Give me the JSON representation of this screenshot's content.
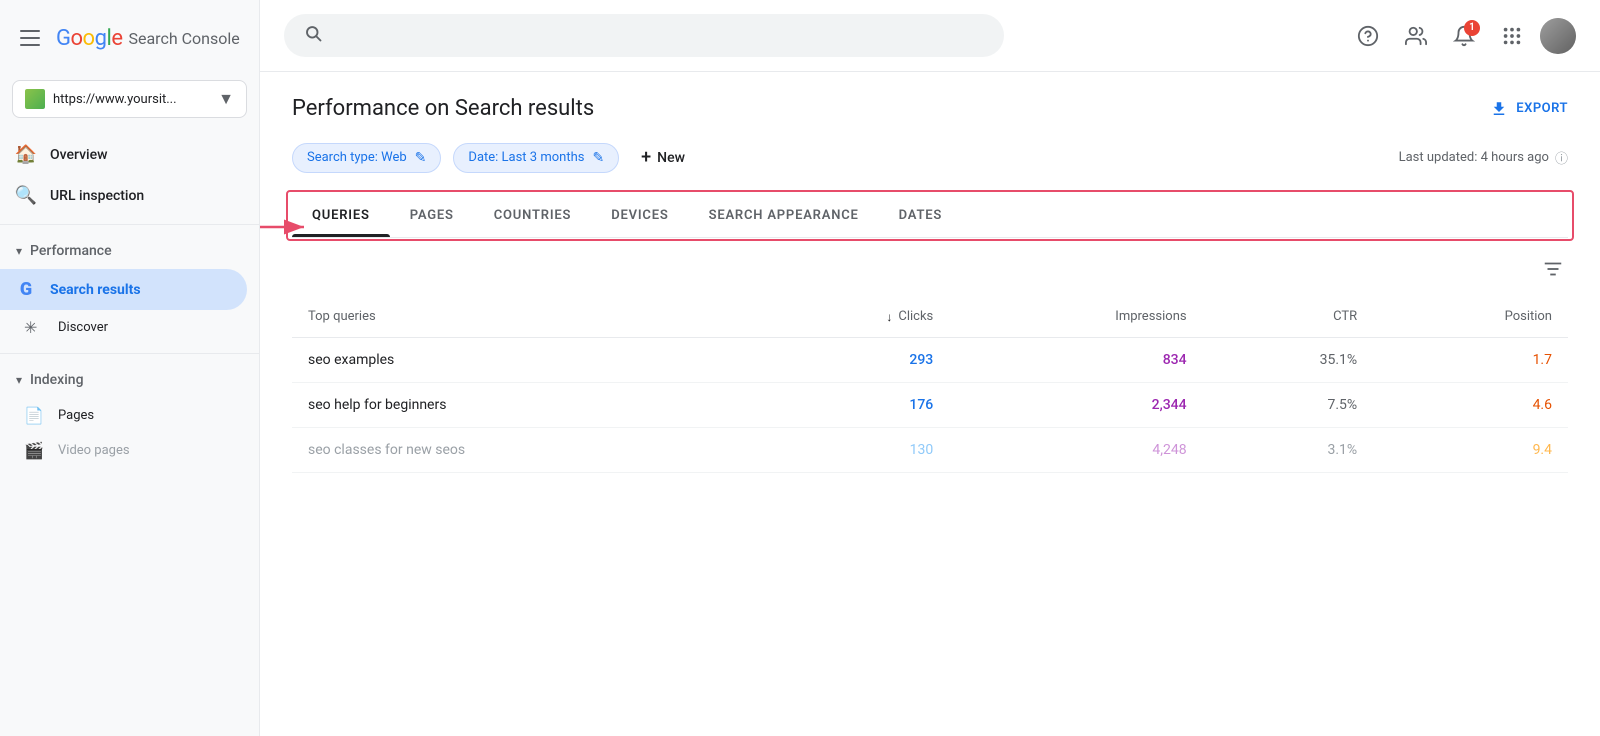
{
  "app": {
    "logo": {
      "google": "Google",
      "console": "Search Console"
    },
    "hamburger_label": "menu"
  },
  "site_selector": {
    "url": "https://www.yoursit...",
    "dropdown_icon": "▼"
  },
  "sidebar": {
    "overview_label": "Overview",
    "url_inspection_label": "URL inspection",
    "performance_label": "Performance",
    "performance_arrow": "▾",
    "search_results_label": "Search results",
    "discover_label": "Discover",
    "indexing_label": "Indexing",
    "indexing_arrow": "▾",
    "pages_label": "Pages",
    "video_pages_label": "Video pages"
  },
  "topbar": {
    "search_placeholder": "",
    "notification_count": "1"
  },
  "page": {
    "title": "Performance on Search results",
    "export_label": "EXPORT",
    "filters": {
      "search_type_label": "Search type: Web",
      "date_label": "Date: Last 3 months",
      "new_label": "New",
      "last_updated": "Last updated: 4 hours ago"
    }
  },
  "tabs": {
    "items": [
      {
        "id": "queries",
        "label": "QUERIES",
        "active": true
      },
      {
        "id": "pages",
        "label": "PAGES",
        "active": false
      },
      {
        "id": "countries",
        "label": "COUNTRIES",
        "active": false
      },
      {
        "id": "devices",
        "label": "DEVICES",
        "active": false
      },
      {
        "id": "search-appearance",
        "label": "SEARCH APPEARANCE",
        "active": false
      },
      {
        "id": "dates",
        "label": "DATES",
        "active": false
      }
    ]
  },
  "table": {
    "headers": {
      "query": "Top queries",
      "clicks": "Clicks",
      "impressions": "Impressions",
      "ctr": "CTR",
      "position": "Position"
    },
    "rows": [
      {
        "query": "seo examples",
        "clicks": "293",
        "impressions": "834",
        "ctr": "35.1%",
        "position": "1.7",
        "faded": false
      },
      {
        "query": "seo help for beginners",
        "clicks": "176",
        "impressions": "2,344",
        "ctr": "7.5%",
        "position": "4.6",
        "faded": false
      },
      {
        "query": "seo classes for new seos",
        "clicks": "130",
        "impressions": "4,248",
        "ctr": "3.1%",
        "position": "9.4",
        "faded": true
      }
    ]
  }
}
